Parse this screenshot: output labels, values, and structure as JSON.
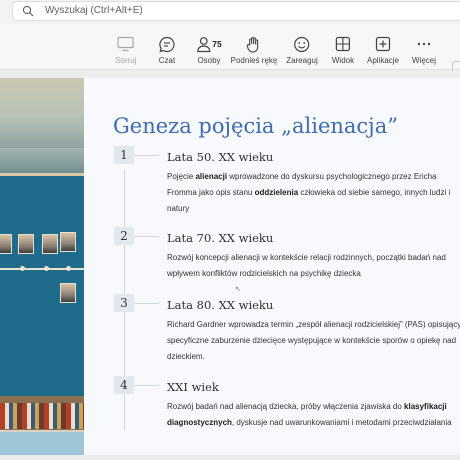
{
  "search": {
    "placeholder": "Wyszukaj (Ctrl+Alt+E)"
  },
  "toolbar": {
    "items": [
      {
        "label": "Steruj",
        "icon": "share-screen-icon",
        "disabled": true
      },
      {
        "label": "Czat",
        "icon": "chat-icon"
      },
      {
        "label": "Osoby",
        "icon": "people-icon",
        "count": "75"
      },
      {
        "label": "Podnieś rękę",
        "icon": "raise-hand-icon"
      },
      {
        "label": "Zareaguj",
        "icon": "smiley-icon"
      },
      {
        "label": "Widok",
        "icon": "grid-view-icon"
      },
      {
        "label": "Aplikacje",
        "icon": "add-apps-icon"
      },
      {
        "label": "Więcej",
        "icon": "more-icon"
      }
    ]
  },
  "slide": {
    "title": "Geneza pojęcia „alienacja”",
    "entries": [
      {
        "number": "1",
        "title": "Lata 50. XX wieku",
        "desc": [
          {
            "t": "Pojęcie "
          },
          {
            "t": "alienacji",
            "b": true
          },
          {
            "t": " wprowadzone do dyskursu psychologicznego przez Ericha Fromma jako opis stanu "
          },
          {
            "t": "oddzielenia",
            "b": true
          },
          {
            "t": " człowieka od siebie samego, innych ludzi i natury"
          }
        ]
      },
      {
        "number": "2",
        "title": "Lata 70. XX wieku",
        "desc": [
          {
            "t": "Rozwój koncepcji alienacji w kontekście relacji rodzinnych, początki badań nad wpływem konfliktów rodzicielskich na psychikę dziecka"
          }
        ]
      },
      {
        "number": "3",
        "title": "Lata 80. XX wieku",
        "desc": [
          {
            "t": "Richard Gardner wprowadza termin „zespół alienacji rodzicielskiej” (PAS) opisujący specyficzne zaburzenie dziecięce występujące w kontekście sporów o opiekę nad dzieckiem."
          }
        ]
      },
      {
        "number": "4",
        "title": "XXI wiek",
        "desc": [
          {
            "t": "Rozwój badań nad alienacją dziecka, próby włączenia zjawiska do "
          },
          {
            "t": "klasyfikacji diagnostycznych",
            "b": true
          },
          {
            "t": ", dyskusje nad uwarunkowaniami i metodami przeciwdziałania"
          }
        ]
      }
    ]
  },
  "colors": {
    "title": "#3f6bb0",
    "toolbar_bg": "#f7f7f7",
    "slide_bg": "#f7f9fc"
  }
}
